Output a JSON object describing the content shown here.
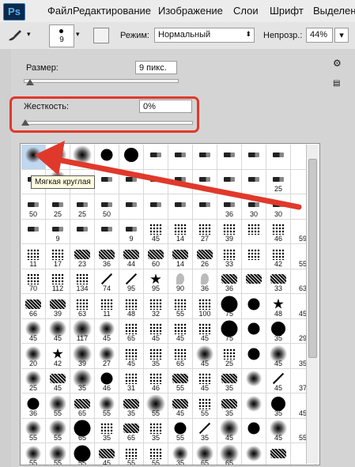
{
  "app": {
    "logo": "Ps"
  },
  "menu": [
    "Файл",
    "Редактирование",
    "Изображение",
    "Слои",
    "Шрифт",
    "Выделение"
  ],
  "options_bar": {
    "brush_size": "9",
    "mode_label": "Режим:",
    "mode_value": "Нормальный",
    "opacity_label": "Непрозр.:",
    "opacity_value": "44%"
  },
  "panel": {
    "size_label": "Размер:",
    "size_value": "9 пикс.",
    "size_slider_fraction": 0.03,
    "hardness_label": "Жесткость:",
    "hardness_value": "0%",
    "hardness_slider_fraction": 0.0
  },
  "tooltip": "Мягкая круглая",
  "presets": {
    "labels": [
      "",
      "",
      "",
      "",
      "",
      "",
      "",
      "",
      "",
      "",
      "",
      "",
      "",
      "",
      "",
      "",
      "",
      "",
      "",
      "",
      "",
      "",
      "25",
      "",
      "50",
      "25",
      "25",
      "50",
      "",
      "",
      "",
      "",
      "36",
      "30",
      "30",
      "",
      "",
      "9",
      "",
      "",
      "9",
      "45",
      "14",
      "27",
      "39",
      "",
      "46",
      "59",
      "11",
      "17",
      "23",
      "36",
      "44",
      "60",
      "14",
      "26",
      "33",
      "",
      "42",
      "55",
      "70",
      "112",
      "134",
      "74",
      "95",
      "95",
      "90",
      "36",
      "36",
      "",
      "33",
      "63",
      "66",
      "39",
      "63",
      "11",
      "48",
      "32",
      "55",
      "100",
      "75",
      "",
      "48",
      "45",
      "45",
      "45",
      "117",
      "45",
      "65",
      "45",
      "45",
      "45",
      "75",
      "",
      "35",
      "29",
      "20",
      "42",
      "39",
      "27",
      "45",
      "35",
      "65",
      "45",
      "25",
      "",
      "45",
      "35",
      "25",
      "45",
      "35",
      "46",
      "31",
      "46",
      "55",
      "45",
      "35",
      "",
      "45",
      "37",
      "36",
      "55",
      "65",
      "55",
      "35",
      "55",
      "45",
      "55",
      "35",
      "",
      "35",
      "45",
      "55",
      "55",
      "65",
      "35",
      "65",
      "35",
      "55",
      "35",
      "45",
      "",
      "45",
      "55",
      "55",
      "55",
      "55",
      "45",
      "55",
      "55",
      "35",
      "65",
      "65",
      ""
    ],
    "shapes": [
      "soft-sel",
      "soft",
      "soft",
      "hard",
      "hard",
      "pen",
      "pen",
      "pen",
      "pen",
      "pen",
      "pen",
      "",
      "pen",
      "soft",
      "pen",
      "pen",
      "pen",
      "pen",
      "pen",
      "pen",
      "pen",
      "pen",
      "pen",
      "",
      "pen",
      "pen",
      "pen",
      "pen",
      "pen",
      "pen",
      "pen",
      "pen",
      "pen",
      "pen",
      "pen",
      "",
      "pen",
      "pen",
      "pen",
      "pen",
      "pen",
      "scatter",
      "scatter",
      "scatter",
      "scatter",
      "scatter",
      "scatter",
      "",
      "scatter",
      "scatter",
      "texture",
      "texture",
      "texture",
      "texture",
      "texture",
      "texture",
      "scatter",
      "scatter",
      "scatter",
      "",
      "scatter",
      "scatter",
      "scatter",
      "line",
      "line",
      "star",
      "leaf",
      "leaf",
      "texture",
      "texture",
      "texture",
      "",
      "texture",
      "texture",
      "scatter",
      "scatter",
      "scatter",
      "scatter",
      "scatter",
      "scatter",
      "hard",
      "hard",
      "star",
      "",
      "soft",
      "soft",
      "soft",
      "soft",
      "scatter",
      "scatter",
      "scatter",
      "scatter",
      "hard",
      "hard",
      "hard",
      "",
      "soft",
      "star",
      "soft",
      "soft",
      "scatter",
      "scatter",
      "scatter",
      "soft",
      "scatter",
      "hard",
      "soft",
      "",
      "soft",
      "texture",
      "soft",
      "hard",
      "scatter",
      "scatter",
      "texture",
      "scatter",
      "texture",
      "soft",
      "line",
      "",
      "hard",
      "soft",
      "texture",
      "soft",
      "texture",
      "soft",
      "texture",
      "scatter",
      "texture",
      "soft",
      "hard",
      "",
      "soft",
      "soft",
      "hard",
      "scatter",
      "texture",
      "scatter",
      "hard",
      "line",
      "soft",
      "hard",
      "soft",
      "",
      "soft",
      "soft",
      "hard",
      "texture",
      "scatter",
      "scatter",
      "soft",
      "soft",
      "soft",
      "soft",
      "texture",
      ""
    ]
  }
}
